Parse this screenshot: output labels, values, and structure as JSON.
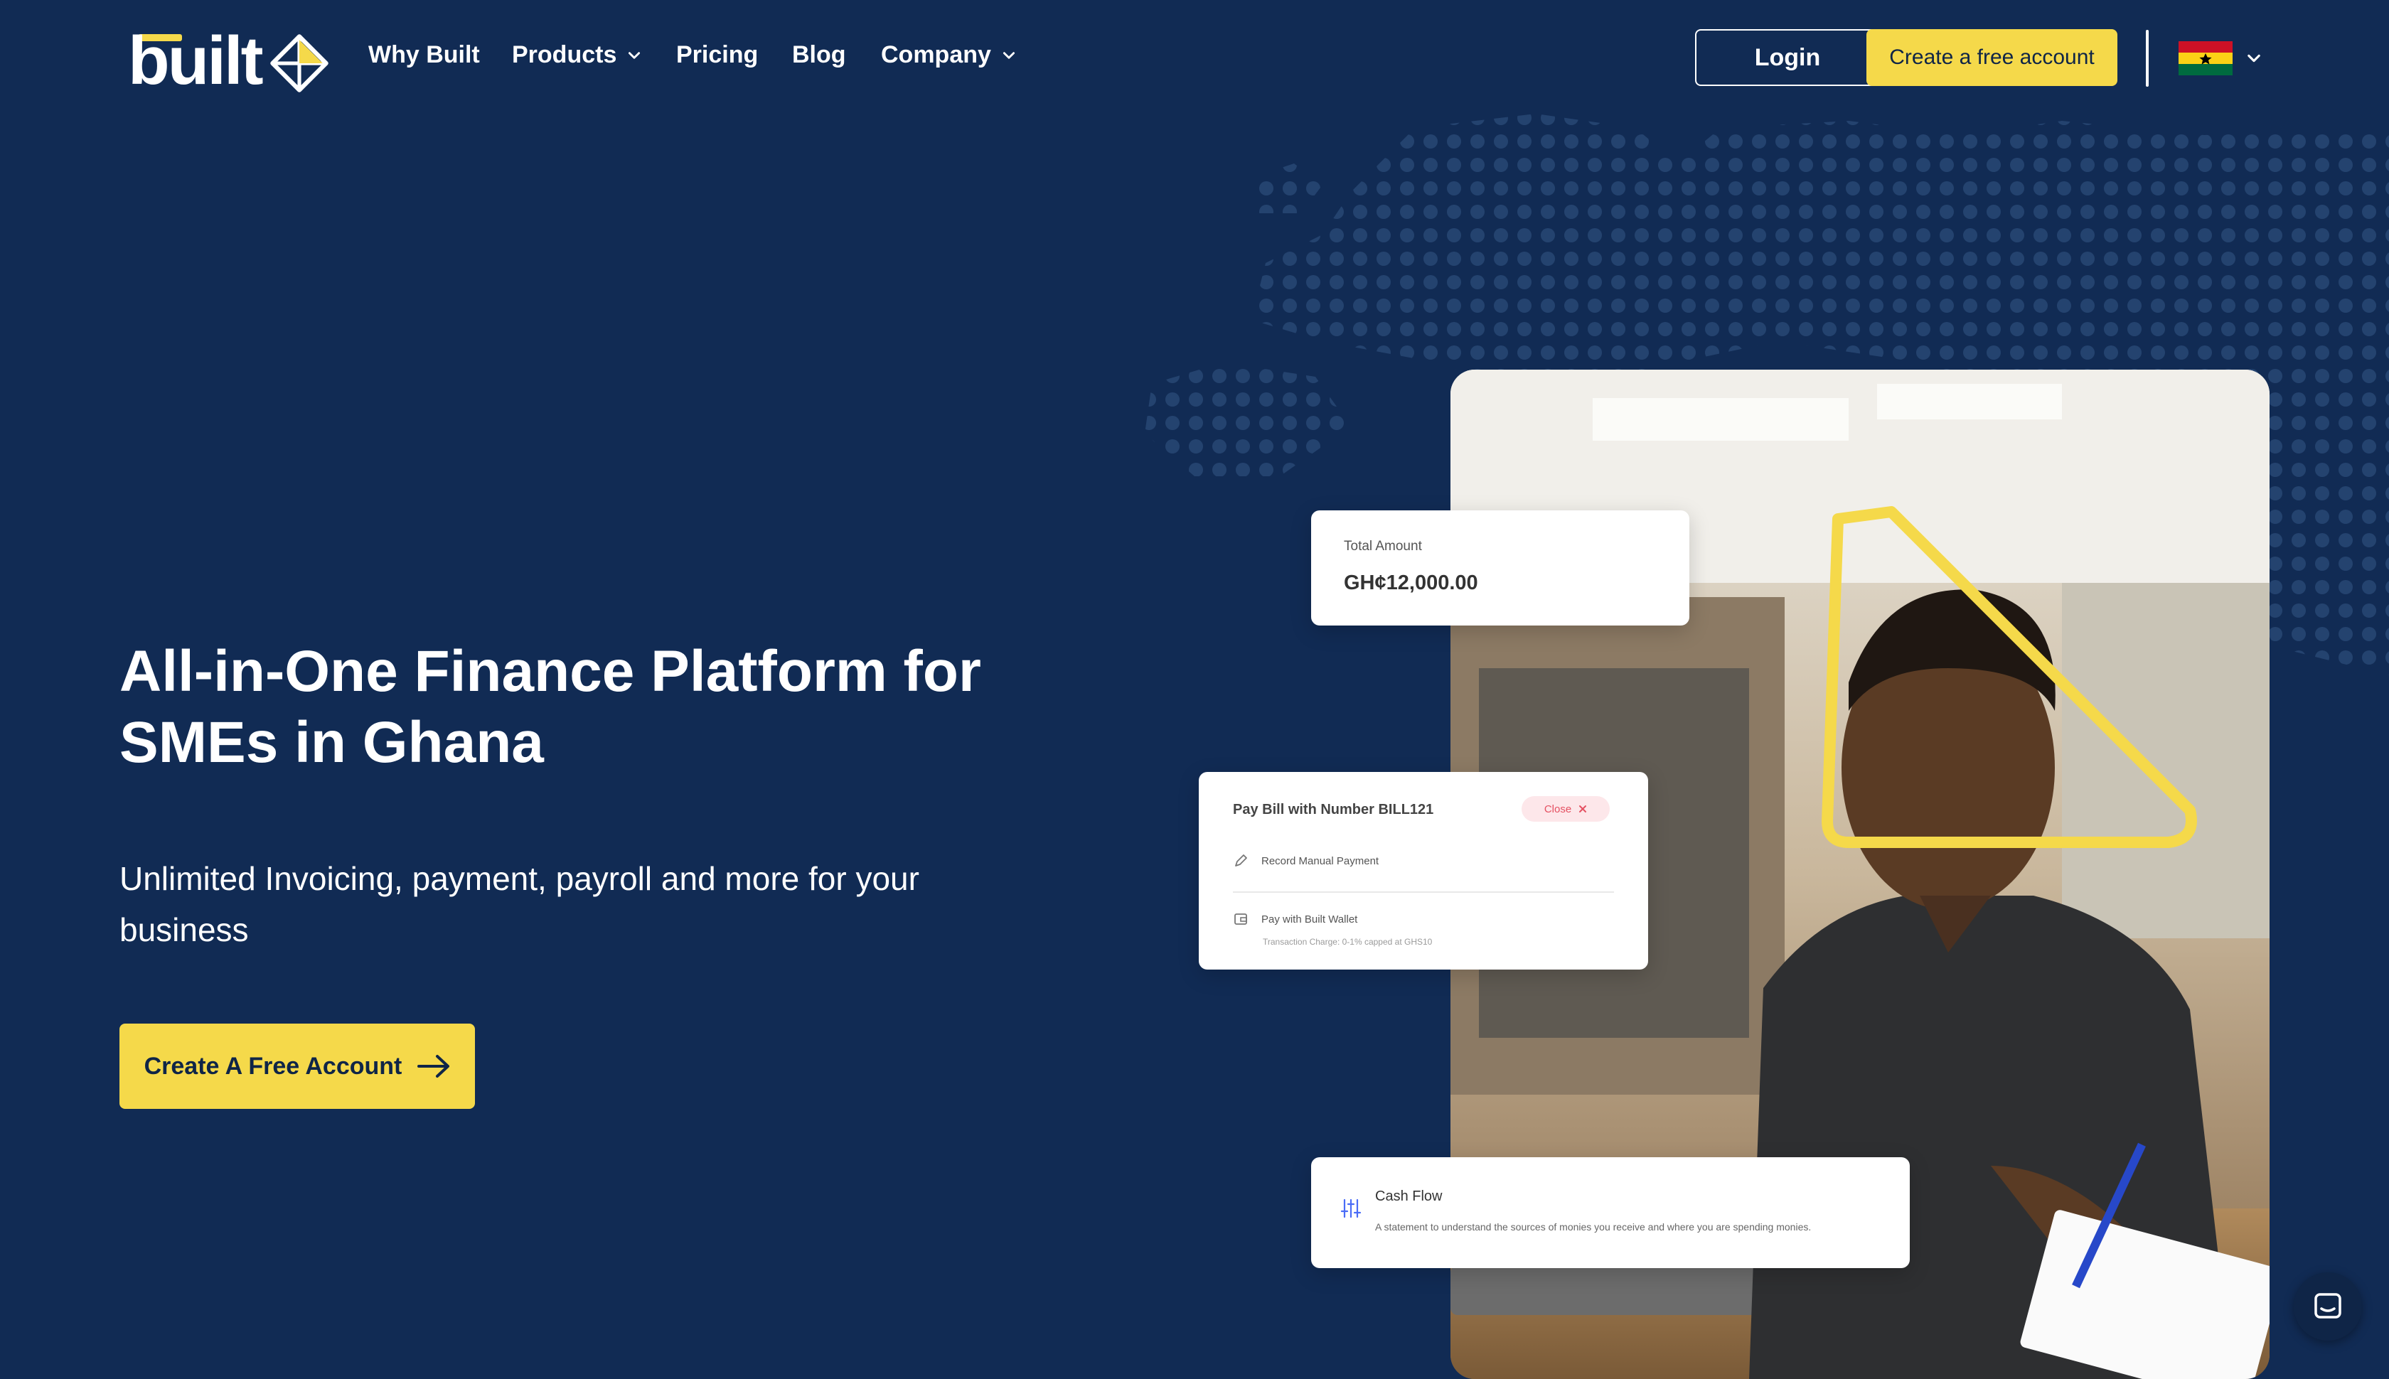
{
  "brand": {
    "logo_text": "built"
  },
  "nav": {
    "links": [
      {
        "label": "Why Built"
      },
      {
        "label": "Products",
        "dropdown": true
      },
      {
        "label": "Pricing"
      },
      {
        "label": "Blog"
      },
      {
        "label": "Company",
        "dropdown": true
      }
    ],
    "login_label": "Login",
    "create_account_label": "Create a free account",
    "country_flag": "ghana-flag-icon"
  },
  "hero": {
    "title": "All-in-One Finance Platform for SMEs in Ghana",
    "subtitle": "Unlimited Invoicing, payment, payroll and more for your business",
    "cta_label": "Create A Free Account"
  },
  "cards": {
    "total": {
      "label": "Total Amount",
      "value": "GH¢12,000.00"
    },
    "bill": {
      "title": "Pay Bill with Number BILL121",
      "close_label": "Close",
      "option1": "Record Manual Payment",
      "option2": "Pay with Built Wallet",
      "option2_note": "Transaction Charge: 0-1% capped at GHS10"
    },
    "cashflow": {
      "title": "Cash Flow",
      "description": "A statement to understand the sources of monies you receive and where you are spending monies."
    }
  },
  "colors": {
    "background": "#112b54",
    "accent": "#f5d94a",
    "text_on_accent": "#0f2547",
    "close_pill_bg": "#fde7ea",
    "close_pill_text": "#e55162"
  }
}
